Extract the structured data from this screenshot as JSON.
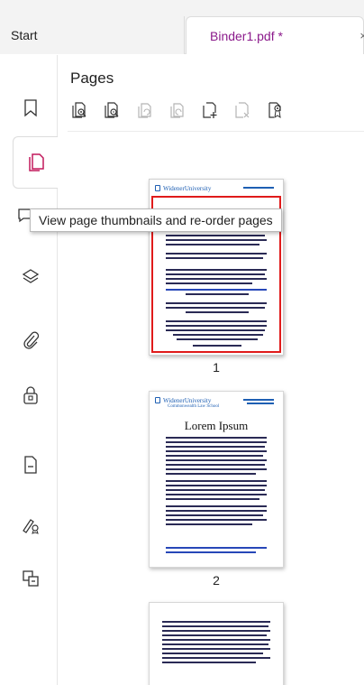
{
  "tabs": [
    {
      "label": "Start",
      "active": false
    },
    {
      "label": "Binder1.pdf *",
      "active": true
    }
  ],
  "tab_close_glyph": "×",
  "rail": {
    "items": [
      {
        "icon": "bookmark-icon"
      },
      {
        "icon": "page-thumbnails-icon",
        "active": true
      },
      {
        "icon": "comment-icon"
      },
      {
        "icon": "layers-icon"
      },
      {
        "icon": "attachment-icon"
      },
      {
        "icon": "lock-icon"
      },
      {
        "icon": "page-icon"
      },
      {
        "icon": "signature-icon"
      },
      {
        "icon": "compare-icon"
      }
    ]
  },
  "panel": {
    "title": "Pages",
    "toolbar": [
      {
        "icon": "zoom-in-thumbnail-icon",
        "enabled": true
      },
      {
        "icon": "zoom-out-thumbnail-icon",
        "enabled": true
      },
      {
        "icon": "rotate-left-icon",
        "enabled": false
      },
      {
        "icon": "rotate-right-icon",
        "enabled": false
      },
      {
        "icon": "insert-page-icon",
        "enabled": true
      },
      {
        "icon": "delete-page-icon",
        "enabled": false
      },
      {
        "icon": "page-properties-icon",
        "enabled": true
      }
    ]
  },
  "tooltip": "View page thumbnails and re-order pages",
  "thumbnails": [
    {
      "page_number": "1",
      "selected": true,
      "header": "WidenerUniversity"
    },
    {
      "page_number": "2",
      "selected": false,
      "header": "WidenerUniversity",
      "header_sub": "Commonwealth Law School",
      "title": "Lorem Ipsum"
    },
    {
      "page_number": "",
      "selected": false
    }
  ],
  "colors": {
    "accent": "#8b1a8b",
    "selection": "#e01b1b",
    "link_blue": "#1e5fb3"
  }
}
